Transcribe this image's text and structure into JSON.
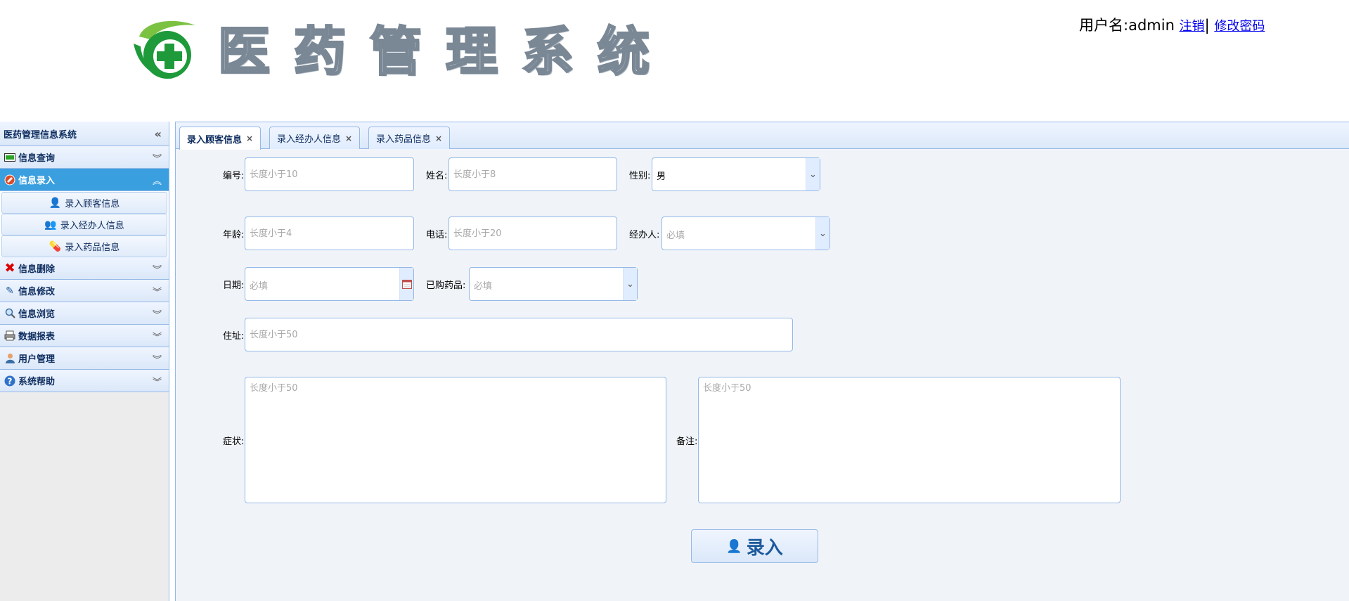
{
  "header": {
    "brand_text": "医药管理系统",
    "user_label": "用户名:admin",
    "logout_link": "注销",
    "separator": "|",
    "change_password_link": "修改密码"
  },
  "sidebar": {
    "title": "医药管理信息系统",
    "sections": [
      {
        "label": "信息查询",
        "icon": "monitor-icon"
      },
      {
        "label": "信息录入",
        "icon": "entry-icon",
        "active": true
      },
      {
        "label": "信息删除",
        "icon": "delete-icon"
      },
      {
        "label": "信息修改",
        "icon": "pencil-icon"
      },
      {
        "label": "信息浏览",
        "icon": "magnifier-icon"
      },
      {
        "label": "数据报表",
        "icon": "printer-icon"
      },
      {
        "label": "用户管理",
        "icon": "user-icon"
      },
      {
        "label": "系统帮助",
        "icon": "help-icon"
      }
    ],
    "entry_items": [
      {
        "label": "录入顾客信息"
      },
      {
        "label": "录入经办人信息"
      },
      {
        "label": "录入药品信息"
      }
    ]
  },
  "tabs": [
    {
      "label": "录入顾客信息",
      "active": true
    },
    {
      "label": "录入经办人信息"
    },
    {
      "label": "录入药品信息"
    }
  ],
  "form": {
    "id": {
      "label": "编号:",
      "placeholder": "长度小于10"
    },
    "name": {
      "label": "姓名:",
      "placeholder": "长度小于8"
    },
    "gender": {
      "label": "性别:",
      "value": "男"
    },
    "age": {
      "label": "年龄:",
      "placeholder": "长度小于4"
    },
    "phone": {
      "label": "电话:",
      "placeholder": "长度小于20"
    },
    "agent": {
      "label": "经办人:",
      "placeholder": "必填"
    },
    "date": {
      "label": "日期:",
      "placeholder": "必填"
    },
    "purchased": {
      "label": "已购药品:",
      "placeholder": "必填"
    },
    "address": {
      "label": "住址:",
      "placeholder": "长度小于50"
    },
    "symptom": {
      "label": "症状:",
      "placeholder": "长度小于50"
    },
    "remark": {
      "label": "备注:",
      "placeholder": "长度小于50"
    },
    "submit_label": "录入"
  },
  "colors": {
    "accent_active": "#3a9fdf",
    "border": "#95b8e7",
    "link": "#0000ee"
  }
}
